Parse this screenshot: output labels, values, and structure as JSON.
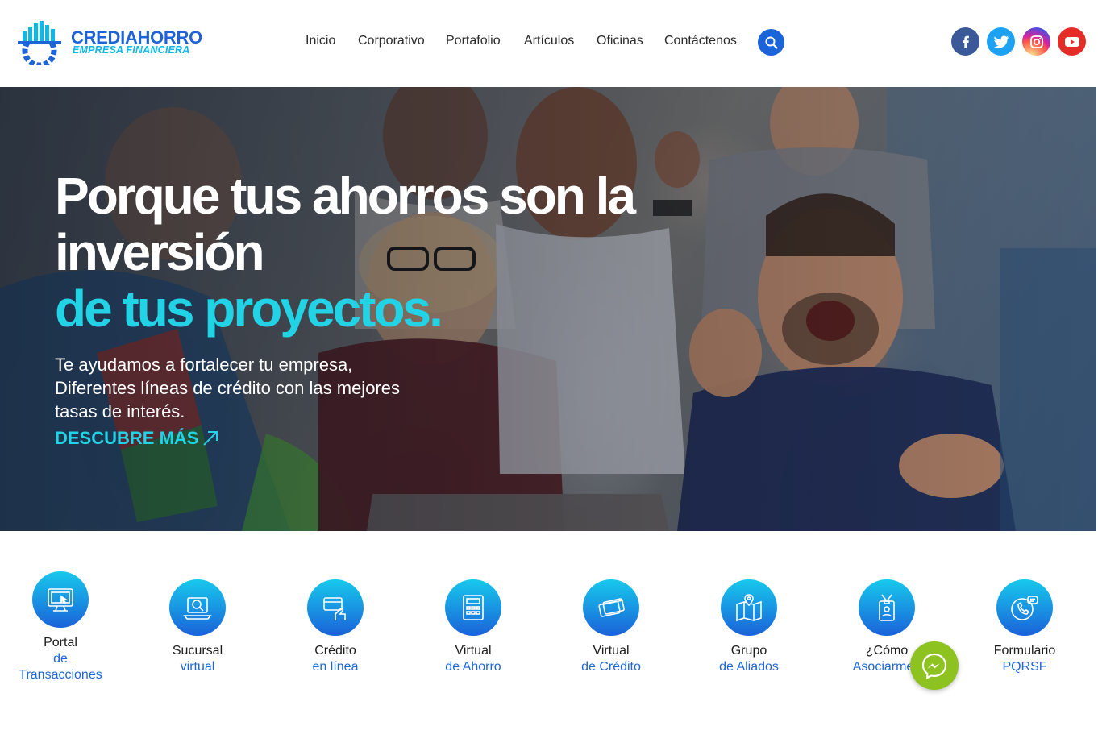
{
  "brand": {
    "name": "CREDIAHORRO",
    "tagline": "EMPRESA FINANCIERA",
    "primary_color": "#1f63d6",
    "accent_color": "#22d3e6"
  },
  "nav": {
    "items": [
      {
        "label": "Inicio"
      },
      {
        "label": "Corporativo"
      },
      {
        "label": "Portafolio"
      },
      {
        "label": "Artículos"
      },
      {
        "label": "Oficinas"
      },
      {
        "label": "Contáctenos"
      }
    ],
    "search_icon": "search-icon"
  },
  "social": [
    {
      "name": "facebook-icon",
      "color": "#3b5998"
    },
    {
      "name": "twitter-icon",
      "color": "#1da1f2"
    },
    {
      "name": "instagram-icon",
      "color": "#d6249f"
    },
    {
      "name": "youtube-icon",
      "color": "#e52d27"
    }
  ],
  "hero": {
    "title_line1": "Porque tus ahorros son la",
    "title_line2": "inversión",
    "title_accent": "de tus proyectos.",
    "subtitle_line1": "Te ayudamos a fortalecer tu empresa,",
    "subtitle_line2": "Diferentes líneas de crédito con las mejores",
    "subtitle_line3": "tasas de interés.",
    "cta": "DESCUBRE MÁS"
  },
  "services": [
    {
      "line1": "Portal",
      "line2": "de",
      "line3": "Transacciones",
      "icon": "monitor-icon"
    },
    {
      "line1": "Sucursal",
      "line2": "virtual",
      "icon": "laptop-search-icon"
    },
    {
      "line1": "Crédito",
      "line2": "en línea",
      "icon": "card-hand-icon"
    },
    {
      "line1": "Virtual",
      "line2": "de Ahorro",
      "icon": "calculator-icon"
    },
    {
      "line1": "Virtual",
      "line2": "de Crédito",
      "icon": "credit-cards-icon"
    },
    {
      "line1": "Grupo",
      "line2": "de Aliados",
      "icon": "map-pin-icon"
    },
    {
      "line1": "¿Cómo",
      "line2": "Asociarme?",
      "icon": "id-badge-icon"
    },
    {
      "line1": "Formulario",
      "line2": "PQRSF",
      "icon": "phone-chat-icon"
    }
  ],
  "messenger": {
    "icon": "messenger-icon",
    "color": "#8dc220"
  }
}
